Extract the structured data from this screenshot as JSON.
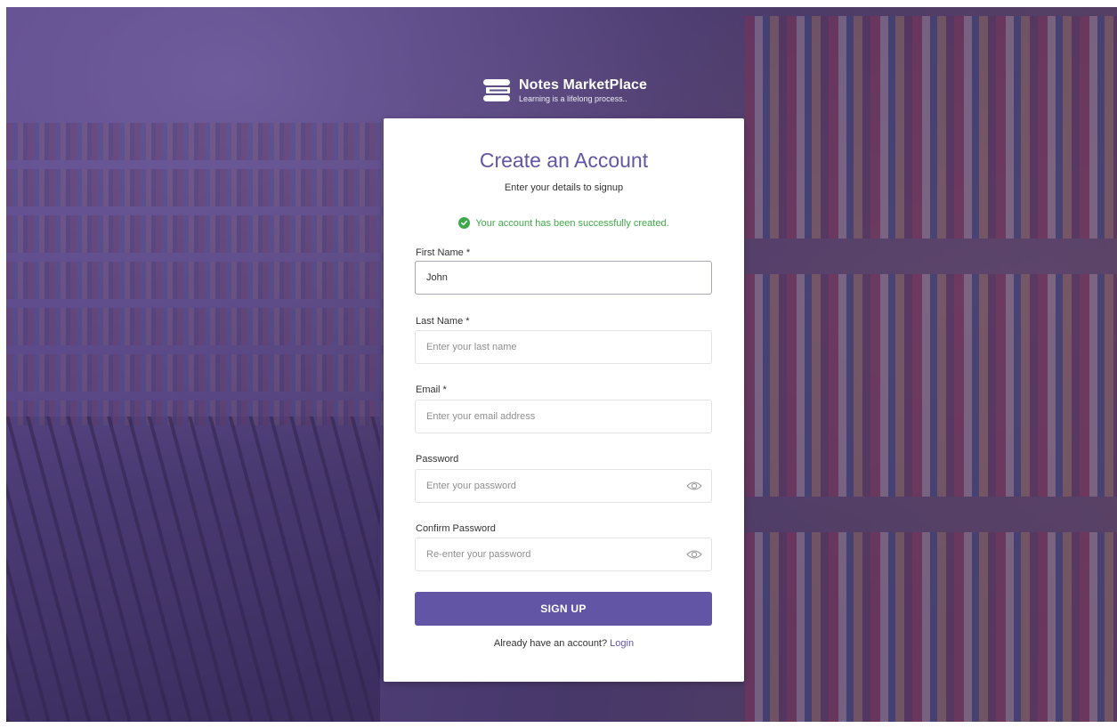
{
  "brand": {
    "name": "Notes MarketPlace",
    "tagline": "Learning is a lifelong process.."
  },
  "form": {
    "title": "Create an Account",
    "subtitle": "Enter your details to signup",
    "success_message": "Your account has been successfully created.",
    "fields": [
      {
        "label": "First Name *",
        "value": "John",
        "placeholder": ""
      },
      {
        "label": "Last Name *",
        "value": "",
        "placeholder": "Enter your last name"
      },
      {
        "label": "Email *",
        "value": "",
        "placeholder": "Enter your email address"
      },
      {
        "label": "Password",
        "value": "",
        "placeholder": "Enter your password"
      },
      {
        "label": "Confirm Password",
        "value": "",
        "placeholder": "Re-enter your password"
      }
    ],
    "submit_label": "SIGN UP",
    "login_prompt": "Already have an account?",
    "login_link": "Login"
  },
  "colors": {
    "accent": "#6255a5",
    "success": "#3ea948"
  },
  "icons": [
    "book-stack-icon",
    "check-circle-icon",
    "eye-icon"
  ]
}
